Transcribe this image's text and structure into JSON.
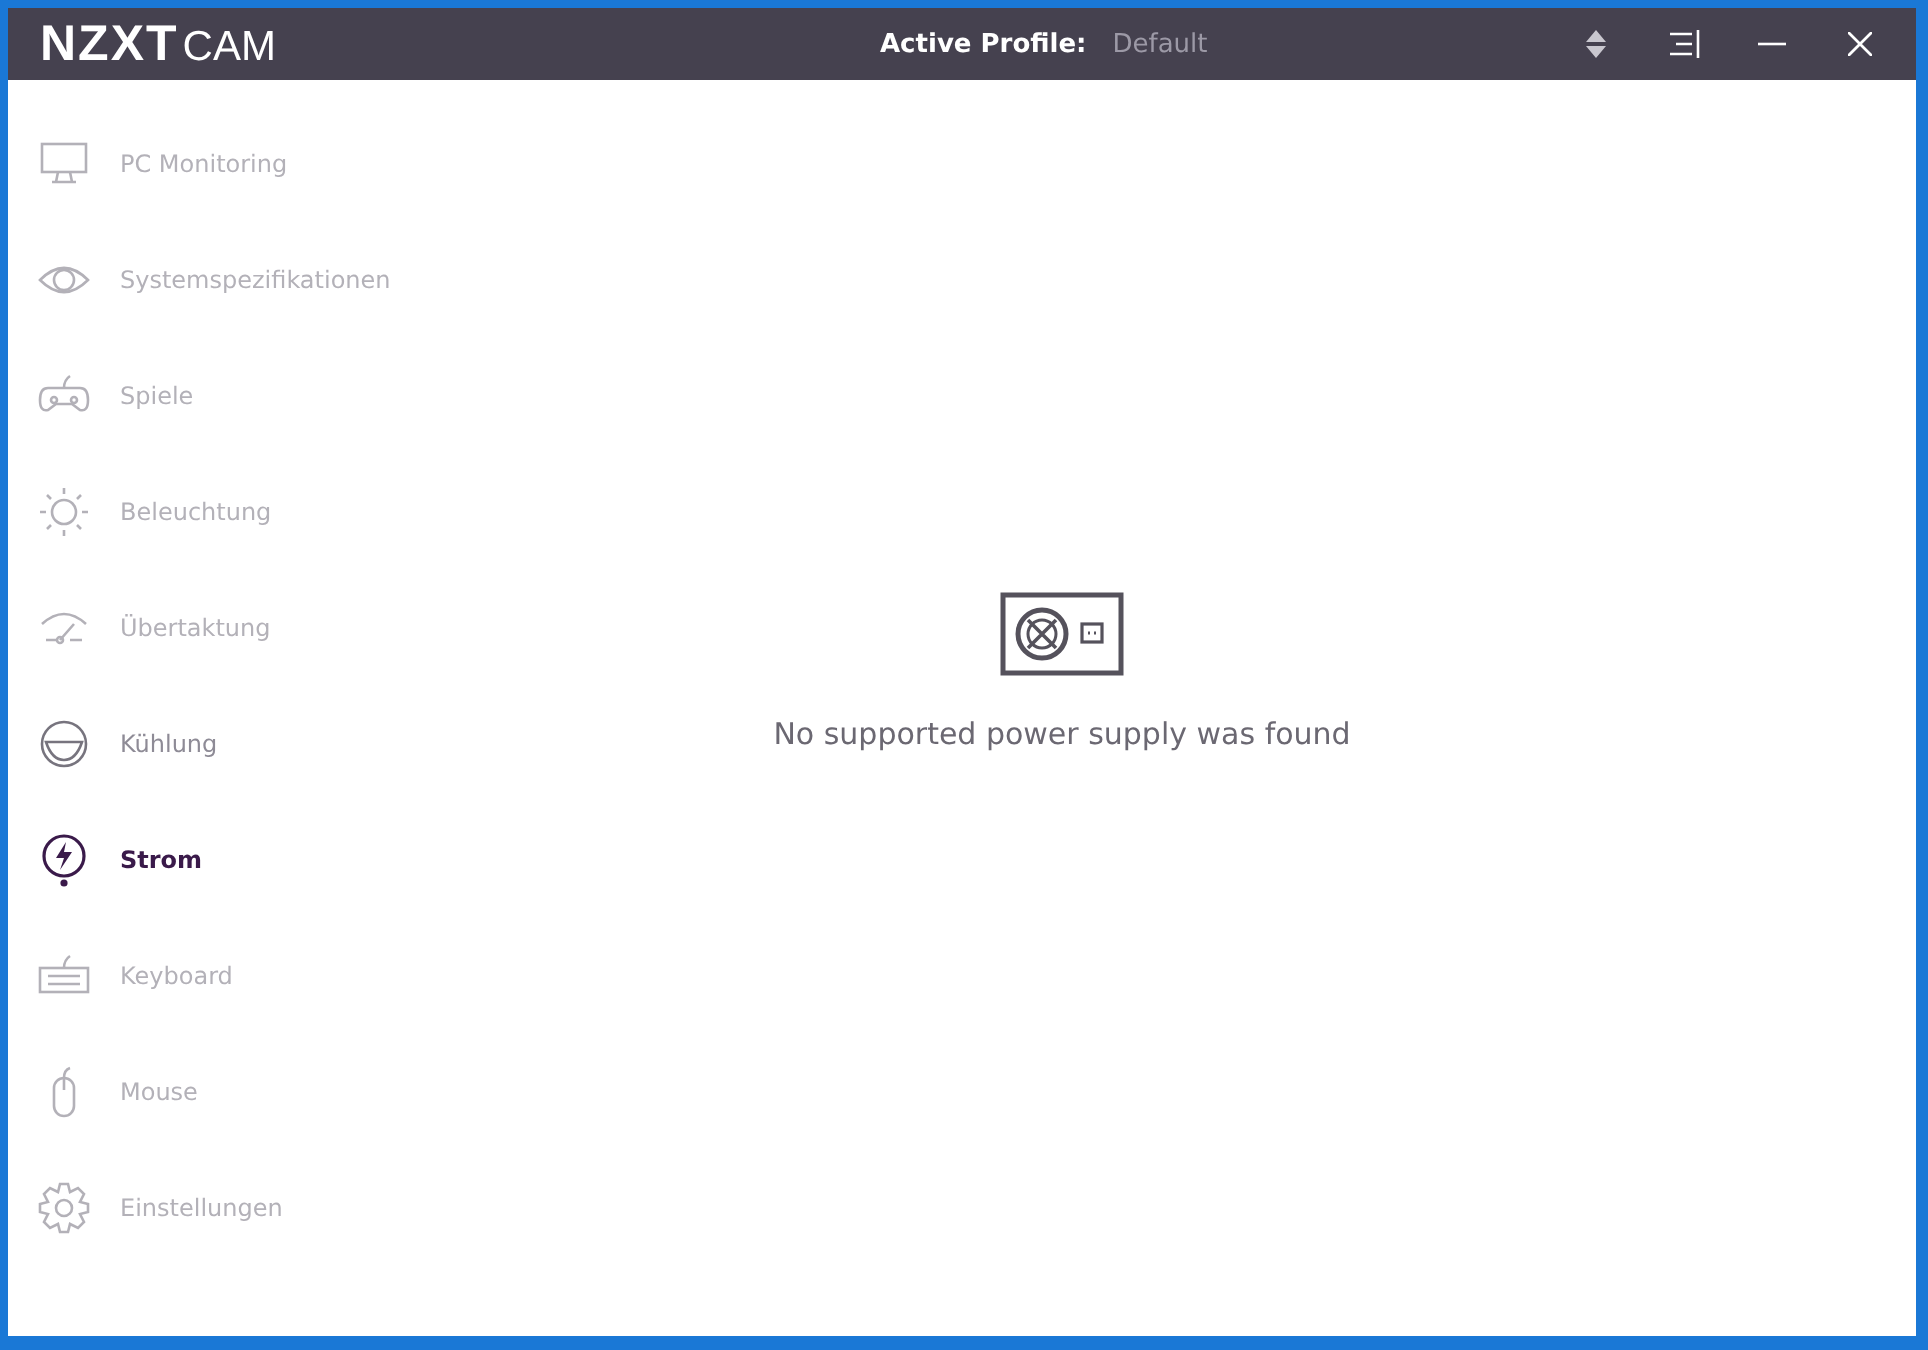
{
  "window": {
    "logo_bold": "NZXT",
    "logo_light": "CAM",
    "profile_label": "Active Profile:",
    "profile_value": "Default"
  },
  "sidebar": {
    "items": [
      {
        "label": "PC Monitoring",
        "selected": false,
        "disabled": true
      },
      {
        "label": "Systemspezifikationen",
        "selected": false,
        "disabled": true
      },
      {
        "label": "Spiele",
        "selected": false,
        "disabled": true
      },
      {
        "label": "Beleuchtung",
        "selected": false,
        "disabled": true
      },
      {
        "label": "Übertaktung",
        "selected": false,
        "disabled": true
      },
      {
        "label": "Kühlung",
        "selected": false,
        "disabled": false
      },
      {
        "label": "Strom",
        "selected": true,
        "disabled": false
      },
      {
        "label": "Keyboard",
        "selected": false,
        "disabled": true
      },
      {
        "label": "Mouse",
        "selected": false,
        "disabled": true
      },
      {
        "label": "Einstellungen",
        "selected": false,
        "disabled": true
      }
    ]
  },
  "content": {
    "message": "No supported power supply was found"
  }
}
